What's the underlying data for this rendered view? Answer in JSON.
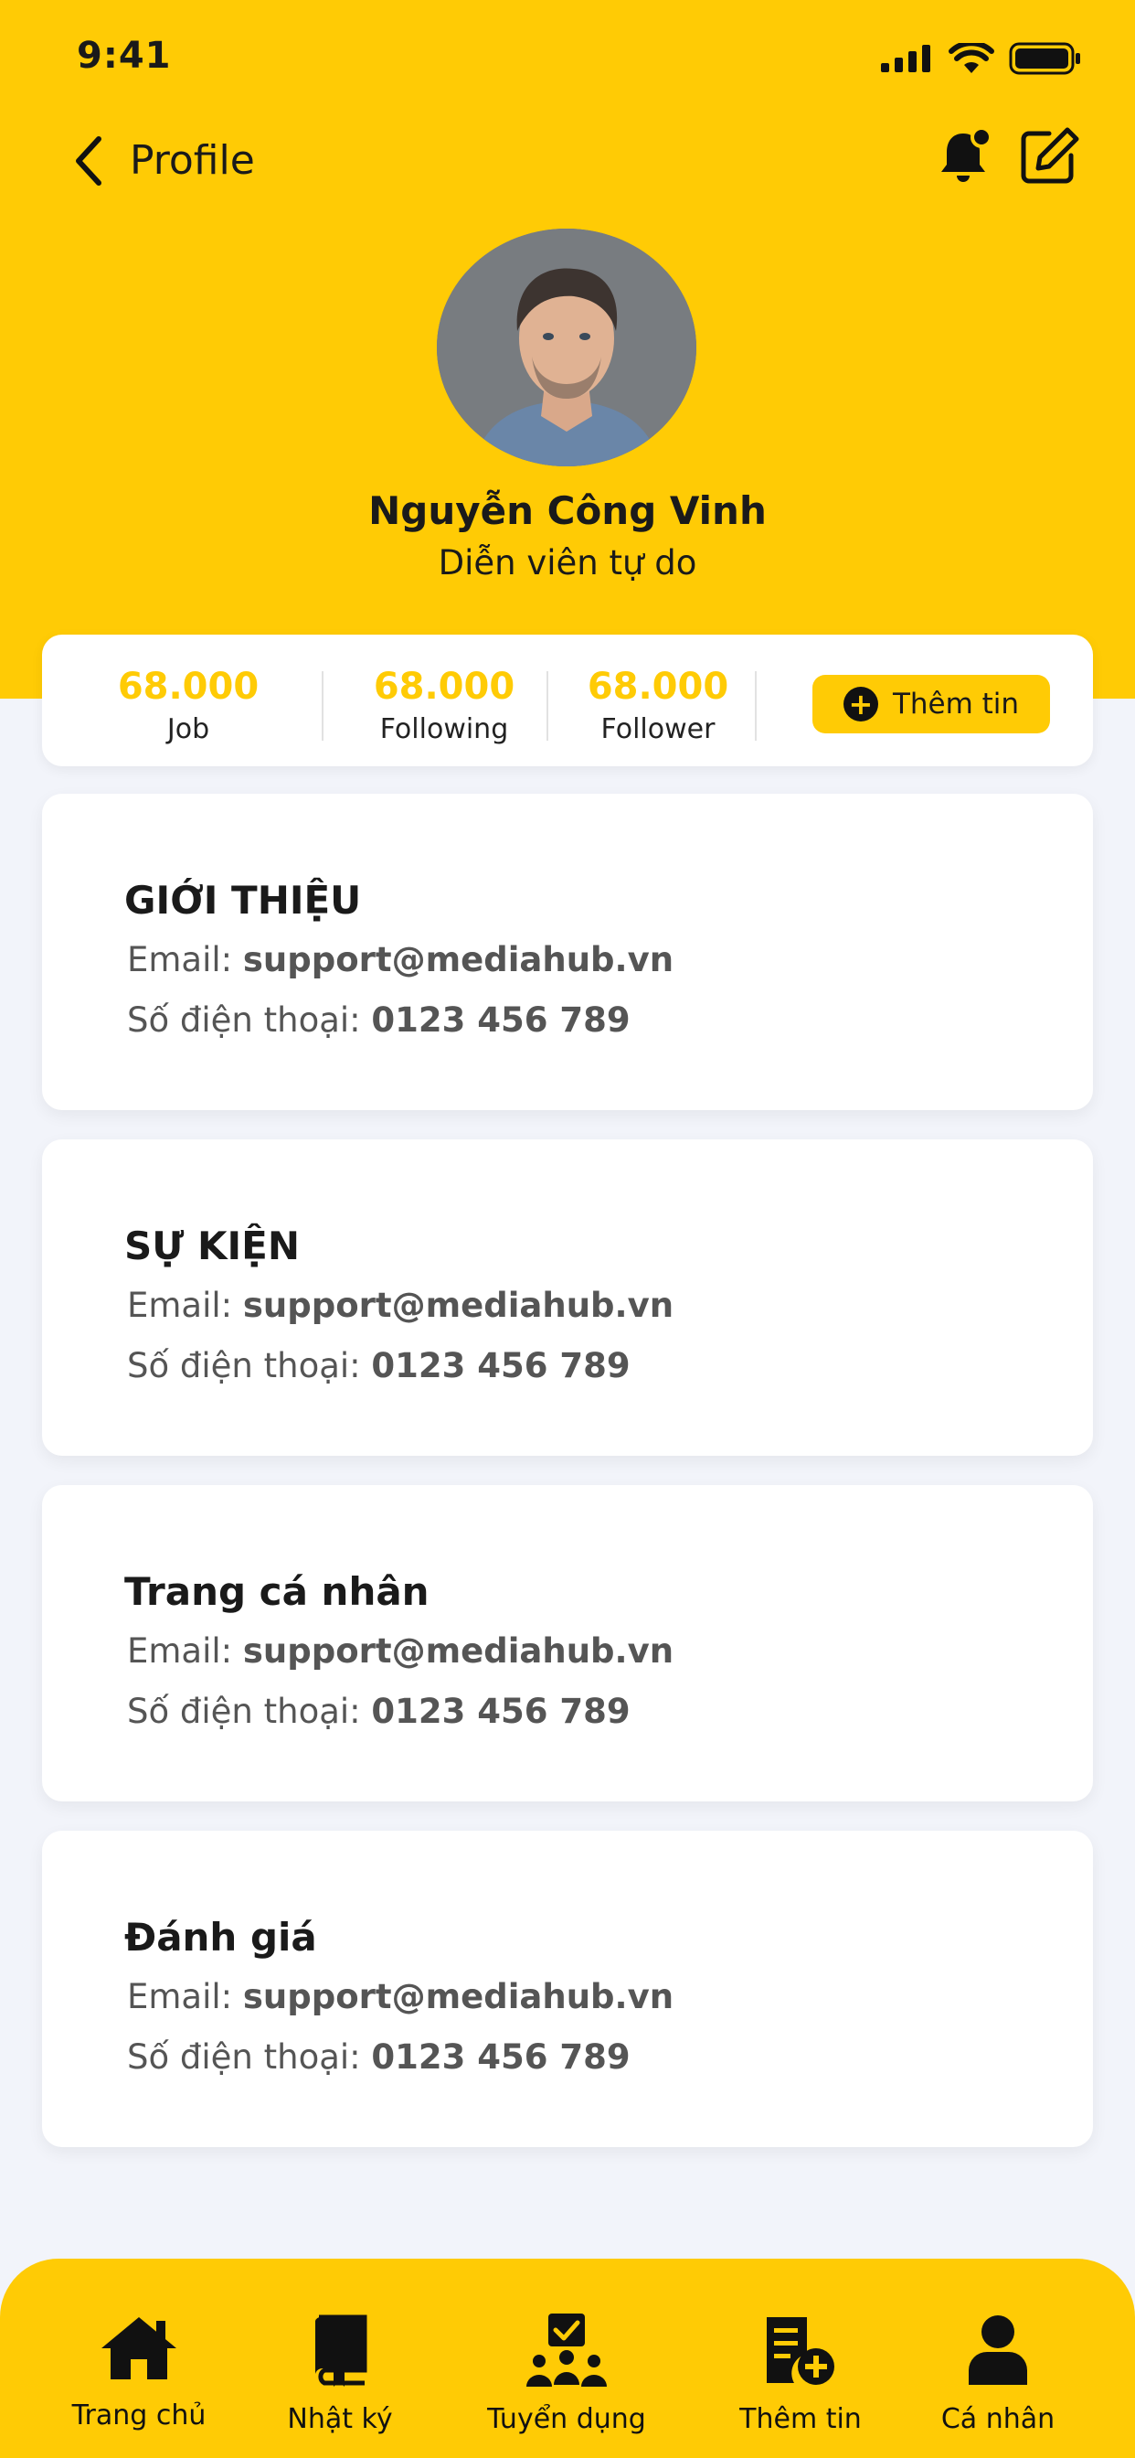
{
  "status_bar": {
    "time": "9:41"
  },
  "nav": {
    "title": "Profile"
  },
  "profile": {
    "name": "Nguyễn Công Vinh",
    "role": "Diễn viên tự do"
  },
  "stats": [
    {
      "value": "68.000",
      "label": "Job"
    },
    {
      "value": "68.000",
      "label": "Following"
    },
    {
      "value": "68.000",
      "label": "Follower"
    }
  ],
  "add_button": {
    "label": "Thêm tin"
  },
  "sections": [
    {
      "title": "GIỚI THIỆU",
      "email_label": "Email: ",
      "email": "support@mediahub.vn",
      "phone_label": "Số điện thoại: ",
      "phone": "0123 456 789"
    },
    {
      "title": "SỰ KIỆN",
      "email_label": "Email: ",
      "email": "support@mediahub.vn",
      "phone_label": "Số điện thoại: ",
      "phone": "0123 456 789"
    },
    {
      "title": "Trang cá nhân",
      "email_label": "Email: ",
      "email": "support@mediahub.vn",
      "phone_label": "Số điện thoại: ",
      "phone": "0123 456 789"
    },
    {
      "title": "Đánh giá",
      "email_label": "Email: ",
      "email": "support@mediahub.vn",
      "phone_label": "Số điện thoại: ",
      "phone": "0123 456 789"
    }
  ],
  "tabs": [
    {
      "label": "Trang chủ",
      "icon": "home-icon"
    },
    {
      "label": "Nhật ký",
      "icon": "book-icon"
    },
    {
      "label": "Tuyển dụng",
      "icon": "recruit-icon"
    },
    {
      "label": "Thêm tin",
      "icon": "add-post-icon"
    },
    {
      "label": "Cá nhân",
      "icon": "user-icon"
    }
  ],
  "colors": {
    "accent": "#ffcb05",
    "background": "#f2f4fa",
    "card": "#ffffff",
    "text": "#1a1a1a"
  }
}
